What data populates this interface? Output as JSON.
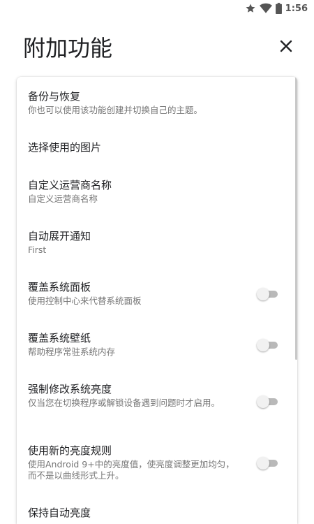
{
  "status_bar": {
    "time": "1:56",
    "icons": [
      "star-icon",
      "wifi-icon",
      "battery-icon"
    ]
  },
  "header": {
    "title": "附加功能",
    "close_icon": "close-icon"
  },
  "settings": [
    {
      "title": "备份与恢复",
      "summary": "你也可以使用该功能创建并切换自己的主题。"
    },
    {
      "title": "选择使用的图片"
    },
    {
      "title": "自定义运营商名称",
      "summary": "自定义运营商名称"
    },
    {
      "title": "自动展开通知",
      "summary": "First"
    },
    {
      "title": "覆盖系统面板",
      "summary": "使用控制中心来代替系统面板",
      "toggle": false
    },
    {
      "title": "覆盖系统壁纸",
      "summary": "帮助程序常驻系统内存",
      "toggle": false
    },
    {
      "title": "强制修改系统亮度",
      "summary": "仅当您在切换程序或解锁设备遇到问题时才启用。",
      "toggle": false
    },
    {
      "title": "使用新的亮度规则",
      "summary": "使用Android 9+中的亮度值，使亮度调整更加均匀，而不是以曲线形式上升。",
      "toggle": false
    },
    {
      "title": "保持自动亮度"
    }
  ],
  "colors": {
    "toggle_off_track": "#b9b9b9",
    "toggle_off_thumb": "#f1f1f1",
    "summary_text": "#757575"
  }
}
